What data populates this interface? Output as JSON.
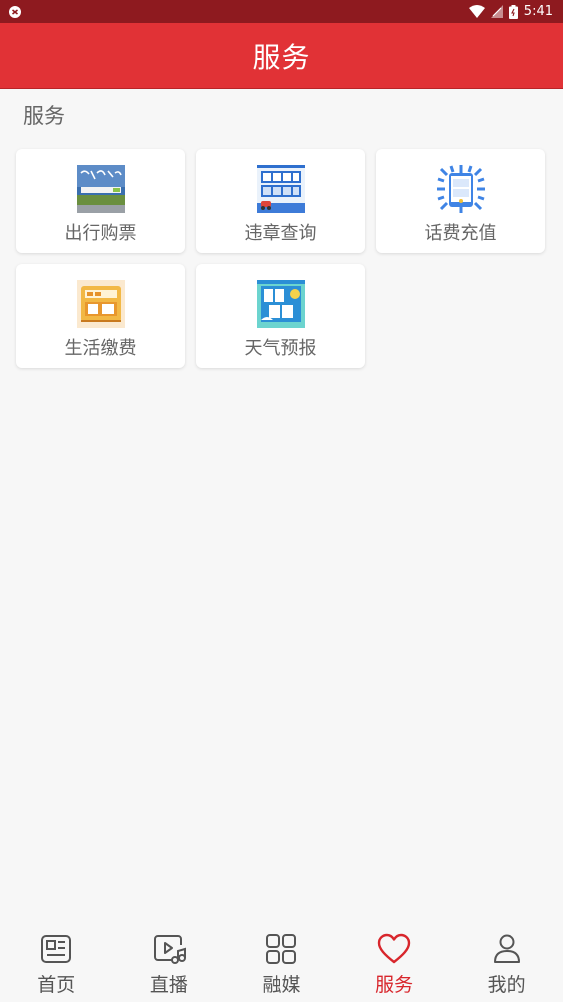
{
  "status_bar": {
    "time": "5:41",
    "bg_color": "#8e1a1f"
  },
  "app_bar": {
    "title": "服务",
    "bg_color": "#e13236"
  },
  "section": {
    "title": "服务"
  },
  "services": [
    {
      "label": "出行购票",
      "icon": "travel-ticket-icon"
    },
    {
      "label": "违章查询",
      "icon": "violation-query-icon"
    },
    {
      "label": "话费充值",
      "icon": "phone-recharge-icon"
    },
    {
      "label": "生活缴费",
      "icon": "utility-payment-icon"
    },
    {
      "label": "天气预报",
      "icon": "weather-forecast-icon"
    }
  ],
  "bottom_nav": {
    "items": [
      {
        "label": "首页",
        "icon": "news-icon",
        "active": false
      },
      {
        "label": "直播",
        "icon": "live-video-icon",
        "active": false
      },
      {
        "label": "融媒",
        "icon": "grid-icon",
        "active": false
      },
      {
        "label": "服务",
        "icon": "heart-icon",
        "active": true
      },
      {
        "label": "我的",
        "icon": "user-icon",
        "active": false
      }
    ],
    "active_color": "#d8262c"
  }
}
